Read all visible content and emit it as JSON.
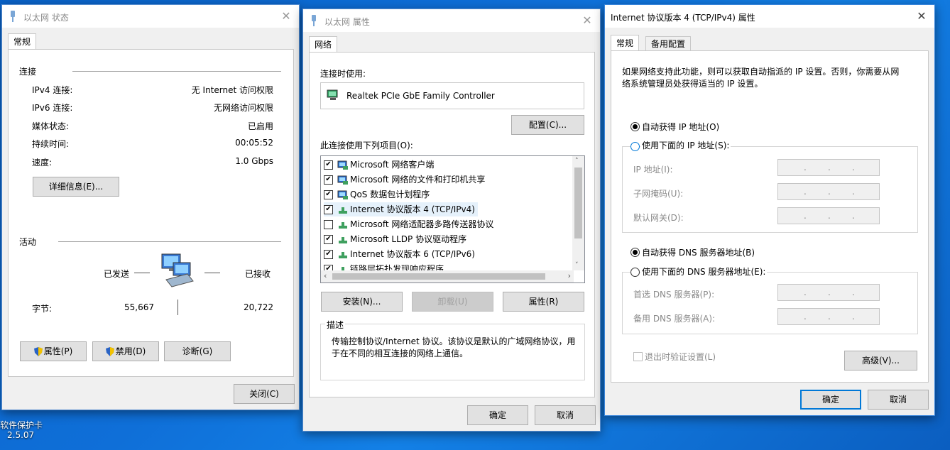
{
  "desktop": {
    "icon_label_1": "软件保护卡",
    "icon_label_2": "2.5.07"
  },
  "status_window": {
    "title": "以太网 状态",
    "tab": "常规",
    "section_connection": "连接",
    "rows": [
      {
        "label": "IPv4 连接:",
        "value": "无 Internet 访问权限"
      },
      {
        "label": "IPv6 连接:",
        "value": "无网络访问权限"
      },
      {
        "label": "媒体状态:",
        "value": "已启用"
      },
      {
        "label": "持续时间:",
        "value": "00:05:52"
      },
      {
        "label": "速度:",
        "value": "1.0 Gbps"
      }
    ],
    "details_button": "详细信息(E)...",
    "section_activity": "活动",
    "sent_label": "已发送",
    "received_label": "已接收",
    "bytes_label": "字节:",
    "bytes_sent": "55,667",
    "bytes_received": "20,722",
    "properties_button": "属性(P)",
    "disable_button": "禁用(D)",
    "diagnose_button": "诊断(G)",
    "close_button": "关闭(C)"
  },
  "properties_window": {
    "title": "以太网 属性",
    "tab": "网络",
    "connect_using_label": "连接时使用:",
    "adapter_name": "Realtek PCIe GbE Family Controller",
    "configure_button": "配置(C)...",
    "items_label": "此连接使用下列项目(O):",
    "items": [
      {
        "label": "Microsoft 网络客户端",
        "checked": true,
        "icon": "network-client-icon"
      },
      {
        "label": "Microsoft 网络的文件和打印机共享",
        "checked": true,
        "icon": "network-client-icon"
      },
      {
        "label": "QoS 数据包计划程序",
        "checked": true,
        "icon": "network-client-icon"
      },
      {
        "label": "Internet 协议版本 4 (TCP/IPv4)",
        "checked": true,
        "icon": "protocol-icon"
      },
      {
        "label": "Microsoft 网络适配器多路传送器协议",
        "checked": false,
        "icon": "protocol-icon"
      },
      {
        "label": "Microsoft LLDP 协议驱动程序",
        "checked": true,
        "icon": "protocol-icon"
      },
      {
        "label": "Internet 协议版本 6 (TCP/IPv6)",
        "checked": true,
        "icon": "protocol-icon"
      },
      {
        "label": "链路层拓扑发现响应程序",
        "checked": true,
        "icon": "protocol-icon"
      }
    ],
    "install_button": "安装(N)...",
    "uninstall_button": "卸载(U)",
    "properties_button": "属性(R)",
    "description_legend": "描述",
    "description_text_line1": "传输控制协议/Internet 协议。该协议是默认的广域网络协议，用",
    "description_text_line2": "于在不同的相互连接的网络上通信。",
    "ok_button": "确定",
    "cancel_button": "取消"
  },
  "ipv4_window": {
    "title": "Internet 协议版本 4 (TCP/IPv4) 属性",
    "tab_general": "常规",
    "tab_alternate": "备用配置",
    "intro_line1": "如果网络支持此功能，则可以获取自动指派的 IP 设置。否则，你需要从网",
    "intro_line2": "络系统管理员处获得适当的 IP 设置。",
    "auto_ip_label": "自动获得 IP 地址(O)",
    "manual_ip_label": "使用下面的 IP 地址(S):",
    "ip_address_label": "IP 地址(I):",
    "subnet_label": "子网掩码(U):",
    "gateway_label": "默认网关(D):",
    "auto_dns_label": "自动获得 DNS 服务器地址(B)",
    "manual_dns_label": "使用下面的 DNS 服务器地址(E):",
    "preferred_dns_label": "首选 DNS 服务器(P):",
    "alternate_dns_label": "备用 DNS 服务器(A):",
    "validate_label": "退出时验证设置(L)",
    "advanced_button": "高级(V)...",
    "ok_button": "确定",
    "cancel_button": "取消",
    "ip_dot": "."
  }
}
